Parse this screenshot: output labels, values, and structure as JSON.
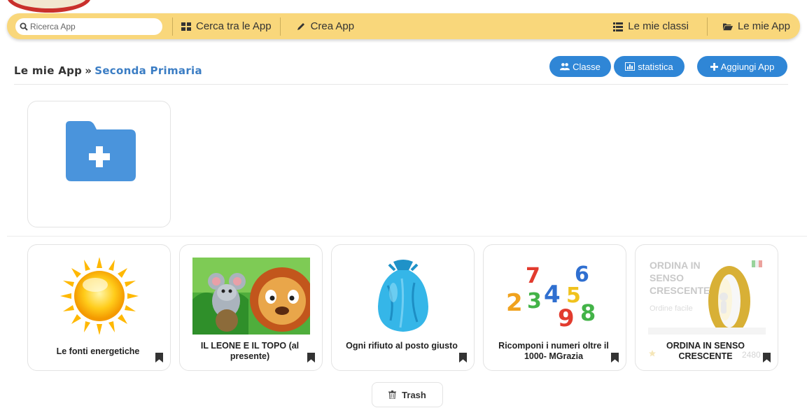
{
  "navbar": {
    "search_placeholder": "Ricerca App",
    "search_apps_label": "Cerca tra le App",
    "create_app_label": "Crea App",
    "my_classes_label": "Le mie classi",
    "my_apps_label": "Le mie App"
  },
  "header": {
    "breadcrumb_root": "Le mie App",
    "breadcrumb_separator": "»",
    "breadcrumb_current": "Seconda Primaria",
    "class_button": "Classe",
    "stats_button": "statistica",
    "add_app_button": "Aggiungi App"
  },
  "apps": [
    {
      "title": "Le fonti energetiche",
      "icon": "sun-image"
    },
    {
      "title": "IL LEONE E IL TOPO (al presente)",
      "icon": "lion-mouse-image"
    },
    {
      "title": "Ogni rifiuto al posto giusto",
      "icon": "trash-bag-image"
    },
    {
      "title": "Ricomponi i numeri oltre il 1000- MGrazia",
      "icon": "numbers-image"
    },
    {
      "title": "ORDINA IN SENSO CRESCENTE",
      "icon": "zero-image"
    }
  ],
  "faded_card": {
    "title_line1": "ORDINA IN",
    "title_line2": "SENSO",
    "title_line3": "CRESCENTE",
    "subtitle": "Ordine facile",
    "number": "2480"
  },
  "trash_label": "Trash",
  "colors": {
    "navbar": "#f9d77b",
    "button": "#2f86d6",
    "folder": "#4a94dc",
    "breadcrumb_accent": "#3b7dc4"
  }
}
